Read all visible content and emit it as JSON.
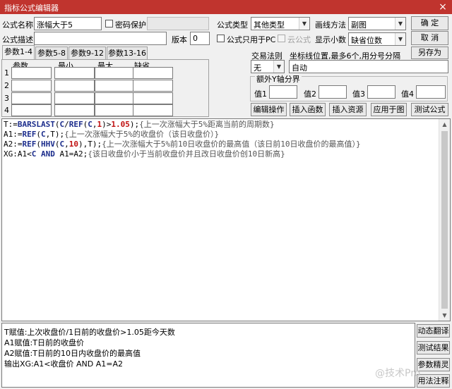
{
  "window": {
    "title": "指标公式编辑器",
    "close_glyph": "×"
  },
  "form": {
    "name_label": "公式名称",
    "name_value": "涨幅大于5",
    "pwd_label": "密码保护",
    "pwd_value": "",
    "desc_label": "公式描述",
    "desc_value": "",
    "version_label": "版本",
    "version_value": "0",
    "type_label": "公式类型",
    "type_value": "其他类型",
    "draw_label": "画线方法",
    "draw_value": "副图",
    "pc_only_label": "公式只用于PC",
    "cloud_label": "云公式",
    "decimals_label": "显示小数",
    "decimals_value": "缺省位数",
    "trade_label": "交易法则",
    "trade_value": "无",
    "coord_label": "坐标线位置,最多6个,用分号分隔",
    "coord_value": "自动",
    "yaxis_label": "额外Y轴分界",
    "yvals": [
      {
        "label": "值1",
        "value": ""
      },
      {
        "label": "值2",
        "value": ""
      },
      {
        "label": "值3",
        "value": ""
      },
      {
        "label": "值4",
        "value": ""
      }
    ]
  },
  "buttons": {
    "ok": "确 定",
    "cancel": "取 消",
    "save_as": "另存为",
    "edit_op": "编辑操作",
    "insert_func": "插入函数",
    "insert_res": "插入资源",
    "apply_chart": "应用于图",
    "test_formula": "测试公式",
    "dyn_translate": "动态翻译",
    "test_result": "测试结果",
    "param_wizard": "参数精灵",
    "usage_notes": "用法注释"
  },
  "tabs": [
    "参数1-4",
    "参数5-8",
    "参数9-12",
    "参数13-16"
  ],
  "params": {
    "headers": [
      "参数",
      "最小",
      "最大",
      "缺省"
    ],
    "rows": [
      "1",
      "2",
      "3",
      "4"
    ]
  },
  "code": {
    "l1": [
      "T:=",
      "BARSLAST",
      "(",
      "C",
      "/",
      "REF",
      "(",
      "C",
      ",",
      "1",
      ")>",
      "1.05",
      ");",
      "{上一次涨幅大于5%距离当前的周期数}"
    ],
    "l2": [
      "A1:=",
      "REF",
      "(",
      "C",
      ",T);",
      "{上一次涨幅大于5%的收盘价（该日收盘价）}"
    ],
    "l3": [
      "A2:=",
      "REF",
      "(",
      "HHV",
      "(",
      "C",
      ",",
      "10",
      "),T);",
      "{上一次涨幅大于5%前10日收盘价的最高值（该日前10日收盘价的最高值）}"
    ],
    "l4": [
      "XG:A1<",
      "C",
      " AND ",
      "A1=A2;",
      "{该日收盘价小于当前收盘价并且改日收盘价创10日新高}"
    ]
  },
  "explain": [
    "T赋值:上次收盘价/1日前的收盘价>1.05距今天数",
    "A1赋值:T日前的收盘价",
    "A2赋值:T日前的10日内收盘价的最高值",
    "输出XG:A1<收盘价 AND A1=A2"
  ],
  "watermark": "@技术Pro"
}
